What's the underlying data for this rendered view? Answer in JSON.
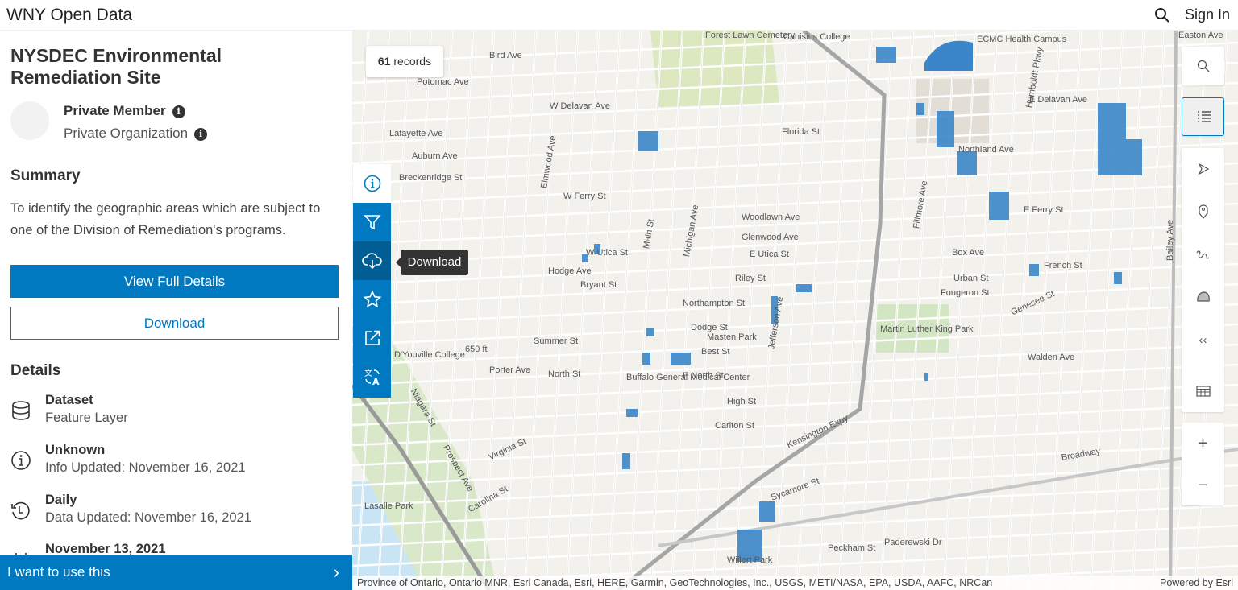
{
  "header": {
    "site_title": "WNY Open Data",
    "sign_in": "Sign In",
    "search_icon": "search-icon"
  },
  "dataset": {
    "title": "NYSDEC Environmental Remediation Site",
    "owner": "Private Member",
    "organization": "Private Organization",
    "summary_heading": "Summary",
    "summary": "To identify the geographic areas which are subject to one of the Division of Remediation's programs.",
    "view_details_label": "View Full Details",
    "download_label": "Download",
    "details_heading": "Details",
    "details": [
      {
        "icon": "database-icon",
        "title": "Dataset",
        "value": "Feature Layer"
      },
      {
        "icon": "info-icon",
        "title": "Unknown",
        "value": "Info Updated: November 16, 2021"
      },
      {
        "icon": "history-icon",
        "title": "Daily",
        "value": "Data Updated: November 16, 2021"
      },
      {
        "icon": "calendar-icon",
        "title": "November 13, 2021",
        "value": ""
      }
    ],
    "use_bar_label": "I want to use this"
  },
  "map": {
    "records_count": "61",
    "records_label": "records",
    "tooltip": "Download",
    "tools": [
      "info-icon",
      "filter-icon",
      "download-icon",
      "star-icon",
      "share-icon",
      "translate-icon"
    ],
    "right_tools": [
      "search-icon",
      "legend-icon",
      "select-icon",
      "point-icon",
      "line-icon",
      "polygon-icon",
      "collapse-icon",
      "table-icon",
      "zoom-in-icon",
      "zoom-out-icon"
    ],
    "attribution": "Province of Ontario, Ontario MNR, Esri Canada, Esri, HERE, Garmin, GeoTechnologies, Inc., USGS, METI/NASA, EPA, USDA, AAFC, NRCan",
    "powered_by": "Powered by Esri",
    "feature_color": "#3a86c8",
    "labels": [
      "Bird Ave",
      "Potomac Ave",
      "W Delavan Ave",
      "Lafayette Ave",
      "Auburn Ave",
      "Breckenridge St",
      "W Ferry St",
      "Forest Lawn Cemetery",
      "Canisius College",
      "ECMC Health Campus",
      "E Delavan Ave",
      "Florida St",
      "Northland Ave",
      "E Ferry St",
      "Woodlawn Ave",
      "Glenwood Ave",
      "E Utica St",
      "W Utica St",
      "Hodge Ave",
      "Bryant St",
      "Riley St",
      "Box Ave",
      "French St",
      "Urban St",
      "Fougeron St",
      "Northampton St",
      "Dodge St",
      "Masten Park",
      "Best St",
      "Summer St",
      "Martin Luther King Park",
      "Walden Ave",
      "Genesee St",
      "Porter Ave",
      "North St",
      "E North St",
      "Buffalo General Medical Center",
      "High St",
      "Carlton St",
      "Kensington Expy",
      "D'Youville College",
      "Broadway",
      "Virginia St",
      "Carolina St",
      "Lasalle Park",
      "Sycamore St",
      "Paderewski Dr",
      "Peckham St",
      "Willert Park",
      "Main St",
      "Michigan Ave",
      "Jefferson Ave",
      "Fillmore Ave",
      "Bailey Ave",
      "Humboldt Pkwy",
      "Elmwood Ave",
      "Niagara St",
      "Prospect Ave",
      "Easton Ave",
      "650 ft"
    ]
  }
}
